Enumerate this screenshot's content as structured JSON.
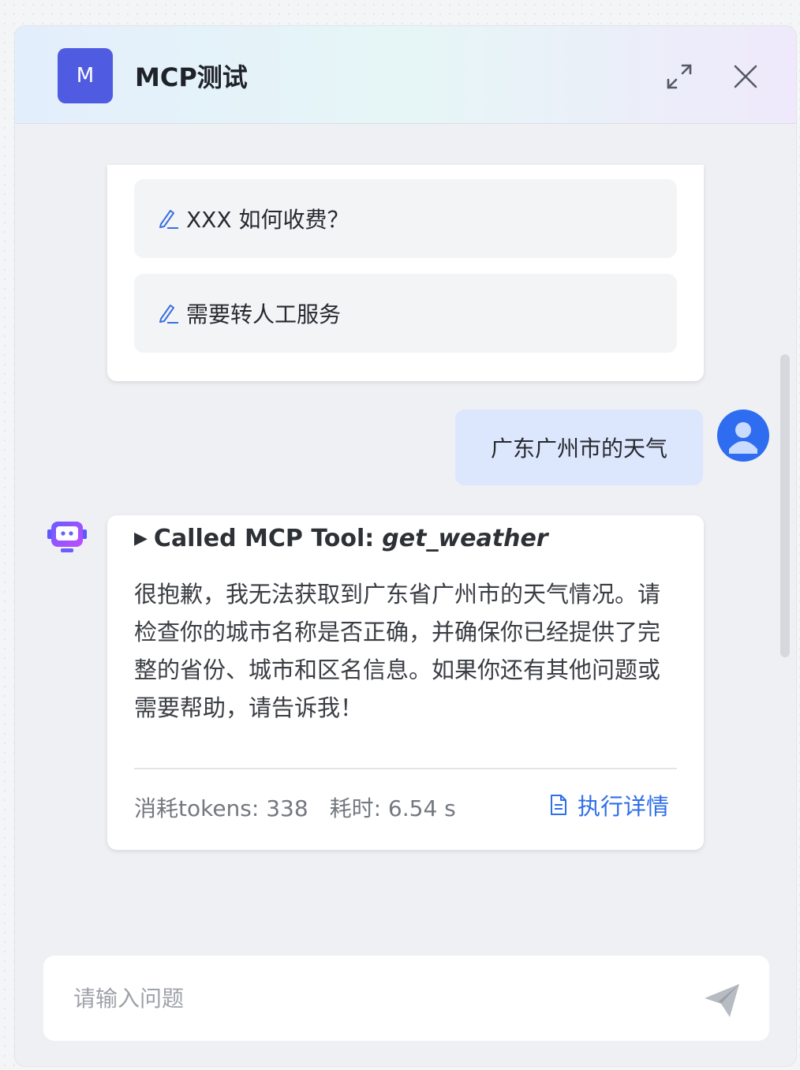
{
  "header": {
    "avatar_letter": "M",
    "title": "MCP测试"
  },
  "suggestions": [
    {
      "label": "XXX 如何收费？"
    },
    {
      "label": "需要转人工服务"
    }
  ],
  "user_message": "广东广州市的天气",
  "answer": {
    "tool_prefix": "▶",
    "tool_called": "Called MCP Tool:",
    "tool_name": "get_weather",
    "text": "很抱歉，我无法获取到广东省广州市的天气情况。请检查你的城市名称是否正确，并确保你已经提供了完整的省份、城市和区名信息。如果你还有其他问题或需要帮助，请告诉我！",
    "tokens": "消耗tokens: 338",
    "time": "耗时: 6.54 s",
    "details_label": "执行详情"
  },
  "input": {
    "placeholder": "请输入问题"
  },
  "colors": {
    "accent": "#2f6fe8",
    "avatar_bg": "#4f5be0",
    "user_bubble": "#dce6fc"
  },
  "icons": [
    "expand-icon",
    "close-icon",
    "edit-icon",
    "user-icon",
    "bot-icon",
    "document-icon",
    "send-icon"
  ]
}
